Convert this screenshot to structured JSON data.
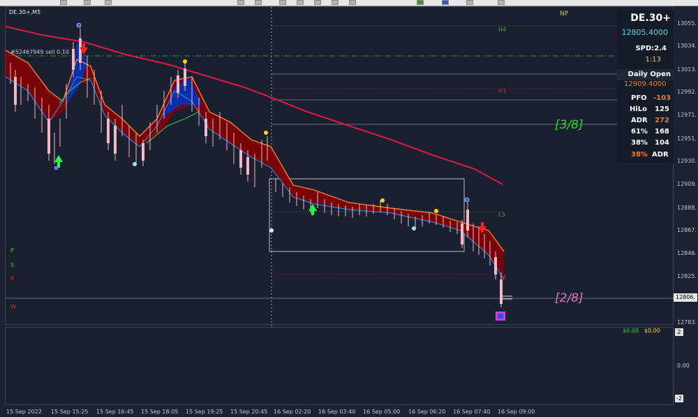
{
  "chart": {
    "symbol_label": "DE.30+,M5",
    "order_label": "#52467949 sell 0.10",
    "np_label": "NP",
    "psr": [
      "P",
      "S",
      "R"
    ],
    "w_label": "W",
    "level_labels": {
      "h4": "H4",
      "h3": "H3",
      "l3": "L3",
      "l4": "L4"
    },
    "murrey": {
      "upper": "[3/8]",
      "lower": "[2/8]"
    }
  },
  "panel": {
    "symbol": "DE.30+",
    "price": "12805.4000",
    "spread": "SPD:2.4",
    "countdown": "1:13",
    "daily_open_label": "Daily Open",
    "daily_open_value": "12909.4000",
    "rows": [
      {
        "label": "PFO",
        "value": "-103"
      },
      {
        "label": "HiLo",
        "value": "125"
      },
      {
        "label": "ADR",
        "value": "272"
      },
      {
        "label": "61%",
        "value": "168"
      },
      {
        "label": "38%",
        "value": "104"
      },
      {
        "label": "38%",
        "value": "ADR"
      }
    ]
  },
  "y_axis": [
    "13055.",
    "13034.",
    "13013.",
    "12992.",
    "12971.",
    "12951.",
    "12930.",
    "12909.",
    "12888.",
    "12867.",
    "12846.",
    "12825.",
    "12806.",
    "12783."
  ],
  "current_price_tag": "12806.",
  "sub_axis": {
    "top": "2",
    "mid": "0.00",
    "bottom": "-2"
  },
  "sub_profit": {
    "left": "$0.00",
    "right": "$0.00"
  },
  "x_axis": [
    "15 Sep 2022",
    "15 Sep 15:25",
    "15 Sep 16:45",
    "15 Sep 18:05",
    "15 Sep 19:25",
    "15 Sep 20:45",
    "16 Sep 02:20",
    "16 Sep 03:40",
    "16 Sep 05:00",
    "16 Sep 06:20",
    "16 Sep 07:40",
    "16 Sep 09:00"
  ],
  "colors": {
    "bg": "#1a2030",
    "up_fill": "#0a2fa8",
    "down_fill": "#8b0000",
    "ma": "#e0184a",
    "grid_green": "#3fae3f",
    "grid_red": "#c23030"
  }
}
